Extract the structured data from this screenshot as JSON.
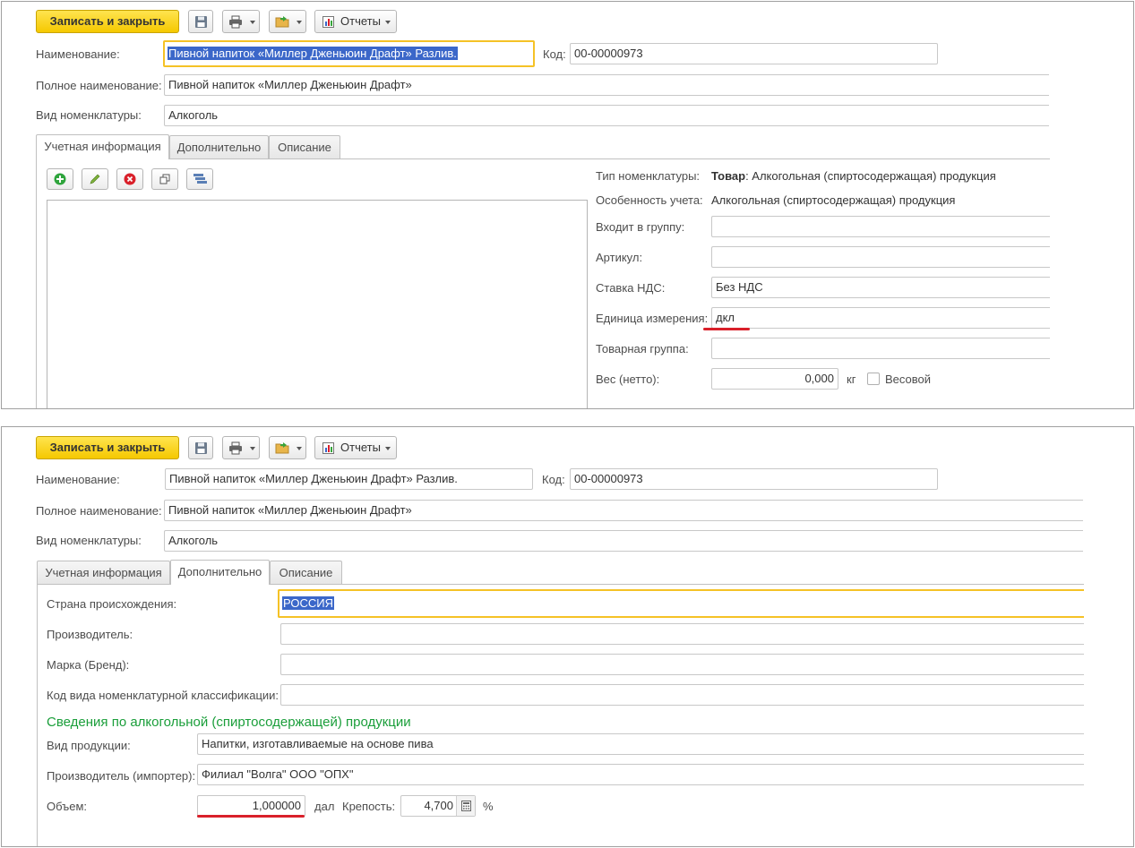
{
  "toolbar": {
    "save_close_label": "Записать и закрыть",
    "save_icon": "floppy-disk-icon",
    "print_icon": "printer-icon",
    "export_icon": "folder-arrow-icon",
    "reports_label": "Отчеты"
  },
  "form": {
    "name_label": "Наименование:",
    "name_value": "Пивной напиток «Миллер Дженьюин Драфт» Разлив.",
    "code_label": "Код:",
    "code_value": "00-00000973",
    "full_name_label": "Полное наименование:",
    "full_name_value": "Пивной напиток «Миллер Дженьюин Драфт»",
    "kind_label": "Вид номенклатуры:",
    "kind_value": "Алкоголь"
  },
  "tabs": {
    "accounting": "Учетная информация",
    "additional": "Дополнительно",
    "description": "Описание"
  },
  "accounting": {
    "type_label": "Тип номенклатуры:",
    "type_value_bold": "Товар",
    "type_value_rest": ": Алкогольная (спиртосодержащая) продукция",
    "feature_label": "Особенность учета:",
    "feature_value": "Алкогольная (спиртосодержащая) продукция",
    "group_label": "Входит в группу:",
    "group_value": "",
    "article_label": "Артикул:",
    "article_value": "",
    "vat_label": "Ставка НДС:",
    "vat_value": "Без НДС",
    "unit_label": "Единица измерения:",
    "unit_value": "дкл",
    "product_group_label": "Товарная группа:",
    "product_group_value": "",
    "weight_label": "Вес (нетто):",
    "weight_value": "0,000",
    "weight_unit": "кг",
    "weighted_label": "Весовой"
  },
  "additional": {
    "country_label": "Страна происхождения:",
    "country_value": "РОССИЯ",
    "manufacturer_label": "Производитель:",
    "manufacturer_value": "",
    "brand_label": "Марка (Бренд):",
    "brand_value": "",
    "classification_label": "Код вида номенклатурной классификации:",
    "classification_value": "",
    "alcohol_section_title": "Сведения по алкогольной (спиртосодержащей) продукции",
    "product_kind_label": "Вид продукции:",
    "product_kind_value": "Напитки, изготавливаемые на основе пива",
    "importer_label": "Производитель (импортер):",
    "importer_value": "Филиал \"Волга\" ООО \"ОПХ\"",
    "volume_label": "Объем:",
    "volume_value": "1,000000",
    "volume_unit": "дал",
    "strength_label": "Крепость:",
    "strength_value": "4,700",
    "strength_unit": "%"
  },
  "colors": {
    "accent_yellow": "#f5c800",
    "focus_border": "#f5c226",
    "selection": "#3b67c9",
    "annotation_red": "#d9202a",
    "section_green": "#1a9e3a"
  }
}
